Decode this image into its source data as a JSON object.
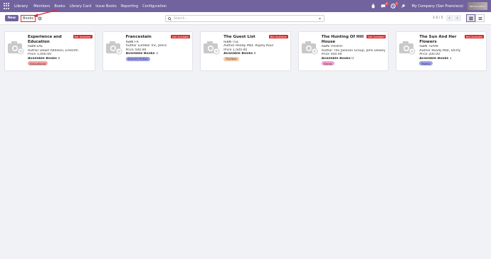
{
  "navbar": {
    "app_name": "Library",
    "menu": [
      "Members",
      "Books",
      "Library Card",
      "Issue Books",
      "Reporting",
      "Configuration"
    ],
    "chat_badge": "4",
    "activity_badge": "3",
    "company": "My Company (San Francisco)",
    "user": "Mitchell Admin"
  },
  "control": {
    "new_label": "New",
    "breadcrumb": "Books",
    "search_placeholder": "Search...",
    "pager": "1-5 / 5"
  },
  "books": [
    {
      "title": "Experience and Education",
      "isbn_label": "ISBN",
      "isbn": "EAE",
      "author_label": "Author",
      "author": "Dewit Addison, Emerith",
      "price_label": "Price",
      "price": "1,000.00",
      "available_label": "Available Books",
      "available": "0",
      "ribbon": "Not Available",
      "tag": "Educational",
      "tag_color": "#f4a3a0"
    },
    {
      "title": "Francestain",
      "isbn_label": "ISBN",
      "isbn": "FR",
      "author_label": "Author",
      "author": "Lumber Inc, Jeera",
      "price_label": "Price",
      "price": "500.00",
      "available_label": "Available Books",
      "available": "3",
      "ribbon": "Not Available",
      "tag": "Science Fiction",
      "tag_color": "#9b9fe6"
    },
    {
      "title": "The Guest List",
      "isbn_label": "ISBN",
      "isbn": "TGL",
      "author_label": "Author",
      "author": "Ready Mat, Rupey Kour",
      "price_label": "Price",
      "price": "1,500.00",
      "available_label": "Available Books",
      "available": "0",
      "ribbon": "Not Available",
      "tag": "Thrillers",
      "tag_color": "#f2c7a8"
    },
    {
      "title": "The Hunting Of Hill House",
      "isbn_label": "ISBN",
      "isbn": "THOHH",
      "author_label": "Author",
      "author": "The Jackson Group, John Dewey",
      "price_label": "Price",
      "price": "500.00",
      "available_label": "Available Books",
      "available": "0",
      "ribbon": "Not Available",
      "tag": "Horror",
      "tag_color": "#f49fd2"
    },
    {
      "title": "The Sun And Her Flowers",
      "isbn_label": "ISBN",
      "isbn": "TSAHF",
      "author_label": "Author",
      "author": "Ready Mat, Shirty",
      "price_label": "Price",
      "price": "200.00",
      "available_label": "Available Books",
      "available": "1",
      "ribbon": "Not Available",
      "tag": "Poetry",
      "tag_color": "#9b9fe6"
    }
  ],
  "colors": {
    "brand": "#71639e",
    "ribbon": "#d82a2a",
    "background": "#f1f2f6"
  }
}
